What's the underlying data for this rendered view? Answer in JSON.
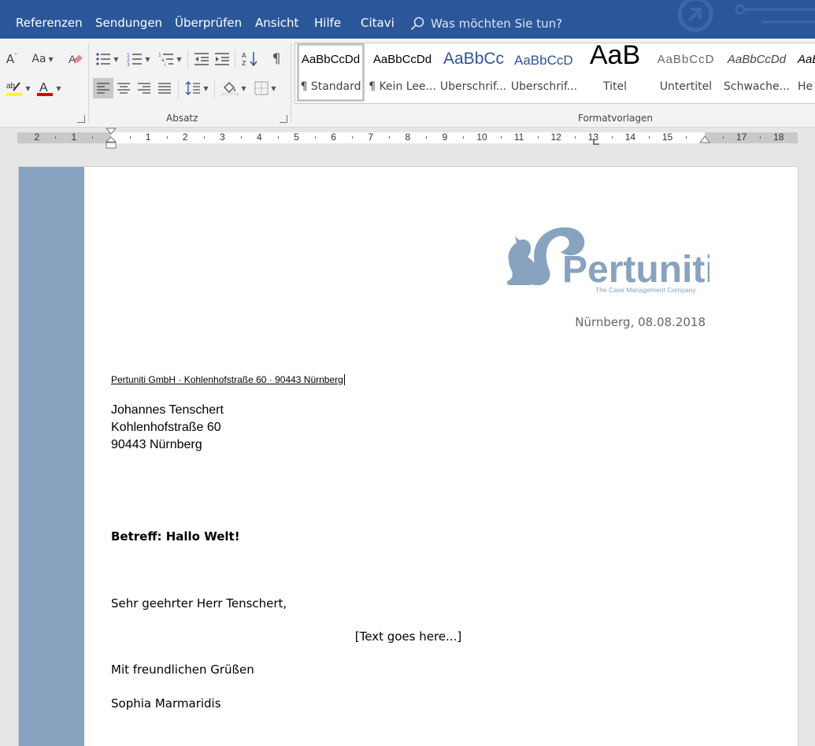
{
  "tabs": [
    {
      "label": "Referenzen"
    },
    {
      "label": "Sendungen"
    },
    {
      "label": "Überprüfen"
    },
    {
      "label": "Ansicht"
    },
    {
      "label": "Hilfe"
    },
    {
      "label": "Citavi"
    }
  ],
  "tell_me": {
    "placeholder": "Was möchten Sie tun?"
  },
  "ribbon": {
    "font_case_label": "Aa",
    "absatz_label": "Absatz",
    "formatvorlagen_label": "Formatvorlagen",
    "highlight_color": "#ffff00",
    "font_color": "#e00000"
  },
  "styles": [
    {
      "preview": "AaBbCcDd",
      "name": "¶ Standard"
    },
    {
      "preview": "AaBbCcDd",
      "name": "¶ Kein Lee..."
    },
    {
      "preview": "AaBbCc",
      "name": "Überschrif..."
    },
    {
      "preview": "AaBbCcD",
      "name": "Überschrif..."
    },
    {
      "preview": "AaB",
      "name": "Titel"
    },
    {
      "preview": "AaBbCcD",
      "name": "Untertitel"
    },
    {
      "preview": "AaBbCcDd",
      "name": "Schwache..."
    },
    {
      "preview": "AaBl",
      "name": "He"
    }
  ],
  "ruler": {
    "numbers": [
      "2",
      "1",
      "1",
      "2",
      "3",
      "4",
      "5",
      "6",
      "7",
      "8",
      "9",
      "10",
      "11",
      "12",
      "13",
      "14",
      "15",
      "17",
      "18"
    ]
  },
  "document": {
    "logo_text": "Pertuniti",
    "logo_tagline": "The Case Management Company",
    "date_line": "Nürnberg, 08.08.2018",
    "sender_line": "Pertuniti GmbH · Kohlenhofstraße 60 · 90443 Nürnberg",
    "recipient": [
      "Johannes Tenschert",
      "Kohlenhofstraße 60",
      "90443 Nürnberg"
    ],
    "subject": "Betreff: Hallo Welt!",
    "salutation": "Sehr geehrter Herr Tenschert,",
    "body_placeholder": "[Text goes here...]",
    "closing": "Mit freundlichen Grüßen",
    "signature": "Sophia Marmaridis",
    "accent_color": "#87a3bf"
  }
}
